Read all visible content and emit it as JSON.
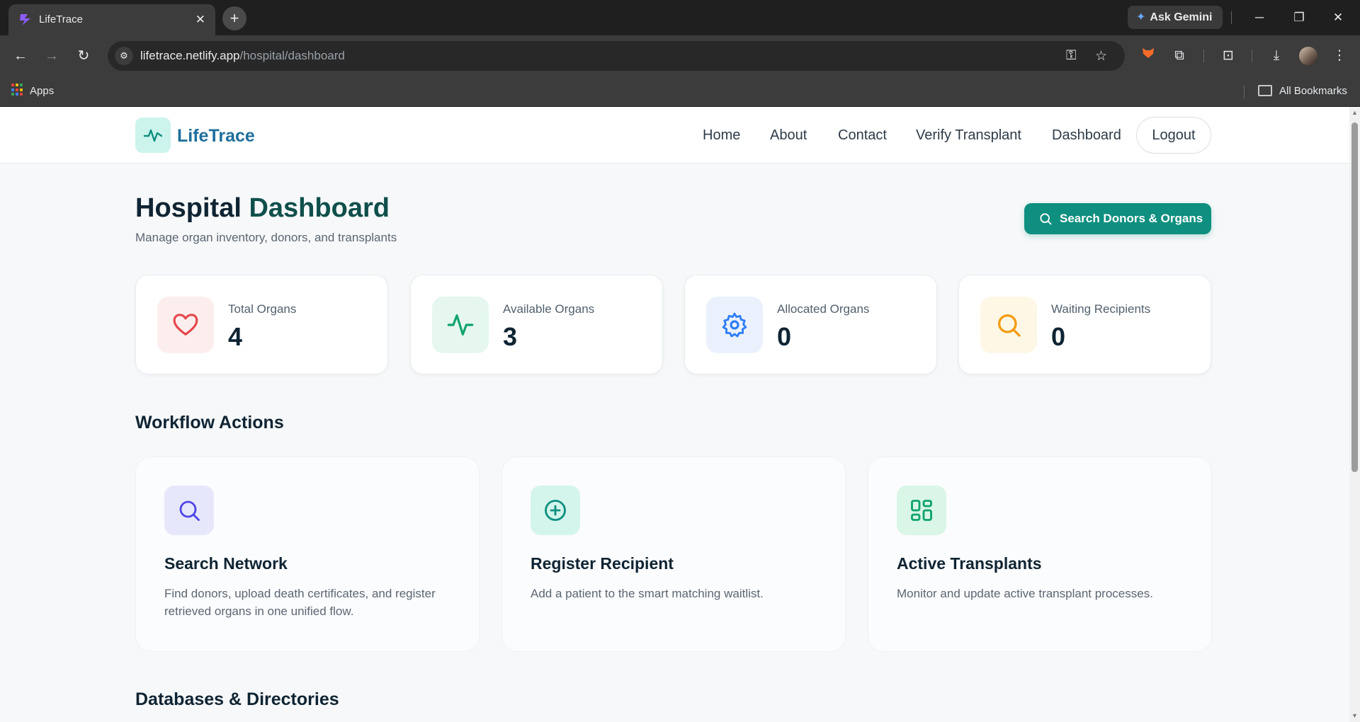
{
  "browser": {
    "tab_title": "LifeTrace",
    "tab_close": "✕",
    "new_tab": "+",
    "ask_gemini": "Ask Gemini",
    "url_domain": "lifetrace.netlify.app",
    "url_path": "/hospital/dashboard",
    "bookmarks": {
      "apps": "Apps",
      "all_bookmarks": "All Bookmarks"
    }
  },
  "site": {
    "logo_text": "LifeTrace",
    "nav": {
      "home": "Home",
      "about": "About",
      "contact": "Contact",
      "verify": "Verify Transplant",
      "dashboard": "Dashboard",
      "logout": "Logout"
    }
  },
  "dashboard": {
    "title_part1": "Hospital",
    "title_part2": "Dashboard",
    "subtitle": "Manage organ inventory, donors, and transplants",
    "search_button": "Search Donors & Organs",
    "stats": [
      {
        "label": "Total Organs",
        "value": "4",
        "icon": "heart-icon",
        "color": "#e5484d",
        "bg": "#fdeeee"
      },
      {
        "label": "Available Organs",
        "value": "3",
        "icon": "pulse-icon",
        "color": "#10a36b",
        "bg": "#e5f7ef"
      },
      {
        "label": "Allocated Organs",
        "value": "0",
        "icon": "gear-icon",
        "color": "#2f7df6",
        "bg": "#eaf1fd"
      },
      {
        "label": "Waiting Recipients",
        "value": "0",
        "icon": "search-icon",
        "color": "#f29d12",
        "bg": "#fef7e6"
      }
    ],
    "workflow_title": "Workflow Actions",
    "workflow": [
      {
        "title": "Search Network",
        "desc": "Find donors, upload death certificates, and register retrieved organs in one unified flow.",
        "icon": "search-icon",
        "color": "#4f46e5",
        "bg": "#e6e7fb"
      },
      {
        "title": "Register Recipient",
        "desc": "Add a patient to the smart matching waitlist.",
        "icon": "plus-circle-icon",
        "color": "#0e8f80",
        "bg": "#d4f5ec"
      },
      {
        "title": "Active Transplants",
        "desc": "Monitor and update active transplant processes.",
        "icon": "grid-icon",
        "color": "#10a36b",
        "bg": "#d9f6e7"
      }
    ],
    "databases_title": "Databases & Directories"
  }
}
